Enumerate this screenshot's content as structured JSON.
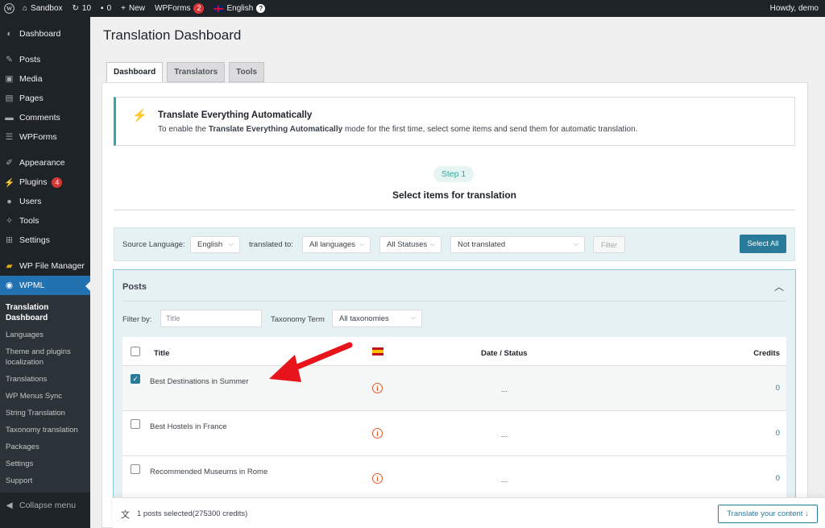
{
  "admin_bar": {
    "site_name": "Sandbox",
    "updates_count": "10",
    "comments_count": "0",
    "new_label": "New",
    "wpforms_label": "WPForms",
    "wpforms_badge": "2",
    "language_label": "English",
    "help_glyph": "?",
    "greeting": "Howdy, demo"
  },
  "sidebar": {
    "items": [
      {
        "label": "Dashboard",
        "icon": "dashboard-icon"
      },
      {
        "label": "Posts",
        "icon": "pin-icon"
      },
      {
        "label": "Media",
        "icon": "media-icon"
      },
      {
        "label": "Pages",
        "icon": "page-icon"
      },
      {
        "label": "Comments",
        "icon": "comment-icon"
      },
      {
        "label": "WPForms",
        "icon": "form-icon"
      },
      {
        "label": "Appearance",
        "icon": "brush-icon"
      },
      {
        "label": "Plugins",
        "icon": "plugin-icon",
        "badge": "4"
      },
      {
        "label": "Users",
        "icon": "user-icon"
      },
      {
        "label": "Tools",
        "icon": "wrench-icon"
      },
      {
        "label": "Settings",
        "icon": "settings-icon"
      },
      {
        "label": "WP File Manager",
        "icon": "folder-icon"
      },
      {
        "label": "WPML",
        "icon": "wpml-icon"
      }
    ],
    "submenu": [
      "Translation Dashboard",
      "Languages",
      "Theme and plugins localization",
      "Translations",
      "WP Menus Sync",
      "String Translation",
      "Taxonomy translation",
      "Packages",
      "Settings",
      "Support"
    ],
    "collapse_label": "Collapse menu"
  },
  "page": {
    "title": "Translation Dashboard",
    "tabs": [
      "Dashboard",
      "Translators",
      "Tools"
    ]
  },
  "notice": {
    "title": "Translate Everything Automatically",
    "text_prefix": "To enable the ",
    "text_bold": "Translate Everything Automatically",
    "text_suffix": " mode for the first time, select some items and send them for automatic translation."
  },
  "step": {
    "badge": "Step 1",
    "title": "Select items for translation"
  },
  "filters": {
    "source_label": "Source Language:",
    "source_value": "English",
    "translated_label": "translated to:",
    "languages_value": "All languages",
    "statuses_value": "All Statuses",
    "translation_value": "Not translated",
    "filter_button": "Filter",
    "select_all": "Select All"
  },
  "posts": {
    "section_title": "Posts",
    "filter_by_label": "Filter by:",
    "title_placeholder": "Title",
    "taxonomy_label": "Taxonomy Term",
    "taxonomy_value": "All taxonomies",
    "columns": {
      "title": "Title",
      "date_status": "Date / Status",
      "credits": "Credits"
    },
    "rows": [
      {
        "title": "Best Destinations in Summer",
        "status": "...",
        "credits": "0",
        "checked": true
      },
      {
        "title": "Best Hostels in France",
        "status": "...",
        "credits": "0",
        "checked": false
      },
      {
        "title": "Recommended Museums in Rome",
        "status": "...",
        "credits": "0",
        "checked": false
      }
    ]
  },
  "bottom_bar": {
    "selection_text": "1 posts selected(275300 credits)",
    "button_label": "Translate your content"
  },
  "colors": {
    "admin_dark": "#1d2327",
    "wp_blue": "#2271b1",
    "wpml_teal": "#33a89e",
    "button_teal": "#2a7a99",
    "badge_red": "#d63638",
    "annotation_arrow": "#e8141b"
  }
}
